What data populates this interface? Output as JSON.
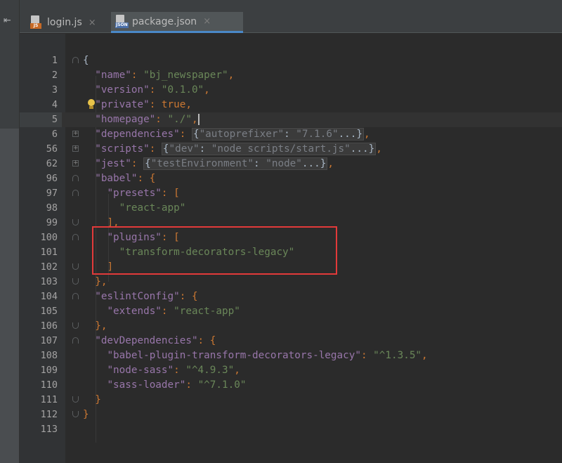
{
  "tabs": [
    {
      "label": "login.js",
      "type_tag": "JS",
      "icon": "js-file-icon",
      "close": "×"
    },
    {
      "label": "package.json",
      "type_tag": "JSON",
      "icon": "json-file-icon",
      "close": "×"
    }
  ],
  "active_tab": "package.json",
  "toolstrip": {
    "collapse_glyph": "⇤",
    "icon": "collapse-panel-icon"
  },
  "colors": {
    "background": "#2b2b2b",
    "key": "#9876aa",
    "string": "#6a8759",
    "keyword": "#cc7832",
    "punctuation": "#a9b7c6",
    "annotation_box": "#e23a3a"
  },
  "editor": {
    "current_line": "5",
    "lines": [
      {
        "num": "1"
      },
      {
        "num": "2"
      },
      {
        "num": "3"
      },
      {
        "num": "4"
      },
      {
        "num": "5"
      },
      {
        "num": "6"
      },
      {
        "num": "56"
      },
      {
        "num": "62"
      },
      {
        "num": "96"
      },
      {
        "num": "97"
      },
      {
        "num": "98"
      },
      {
        "num": "99"
      },
      {
        "num": "100"
      },
      {
        "num": "101"
      },
      {
        "num": "102"
      },
      {
        "num": "103"
      },
      {
        "num": "104"
      },
      {
        "num": "105"
      },
      {
        "num": "106"
      },
      {
        "num": "107"
      },
      {
        "num": "108"
      },
      {
        "num": "109"
      },
      {
        "num": "110"
      },
      {
        "num": "111"
      },
      {
        "num": "112"
      },
      {
        "num": "113"
      }
    ],
    "tokens": {
      "l1": "{",
      "name_key": "\"name\"",
      "name_val": "\"bj_newspaper\"",
      "version_key": "\"version\"",
      "version_val": "\"0.1.0\"",
      "private_key": "\"private\"",
      "private_val": "true",
      "homepage_key": "\"homepage\"",
      "homepage_val": "\"./\"",
      "deps_key": "\"dependencies\"",
      "deps_folded_key": "\"autoprefixer\"",
      "deps_folded_val": "\"7.1.6\"",
      "scripts_key": "\"scripts\"",
      "scripts_folded_key": "\"dev\"",
      "scripts_folded_val": "\"node scripts/start.js\"",
      "jest_key": "\"jest\"",
      "jest_folded_key": "\"testEnvironment\"",
      "jest_folded_val": "\"node\"",
      "babel_key": "\"babel\"",
      "presets_key": "\"presets\"",
      "presets_item": "\"react-app\"",
      "plugins_key": "\"plugins\"",
      "plugins_item": "\"transform-decorators-legacy\"",
      "eslint_key": "\"eslintConfig\"",
      "extends_key": "\"extends\"",
      "extends_val": "\"react-app\"",
      "devdeps_key": "\"devDependencies\"",
      "dd1_key": "\"babel-plugin-transform-decorators-legacy\"",
      "dd1_val": "\"^1.3.5\"",
      "dd2_key": "\"node-sass\"",
      "dd2_val": "\"^4.9.3\"",
      "dd3_key": "\"sass-loader\"",
      "dd3_val": "\"^7.1.0\""
    }
  }
}
